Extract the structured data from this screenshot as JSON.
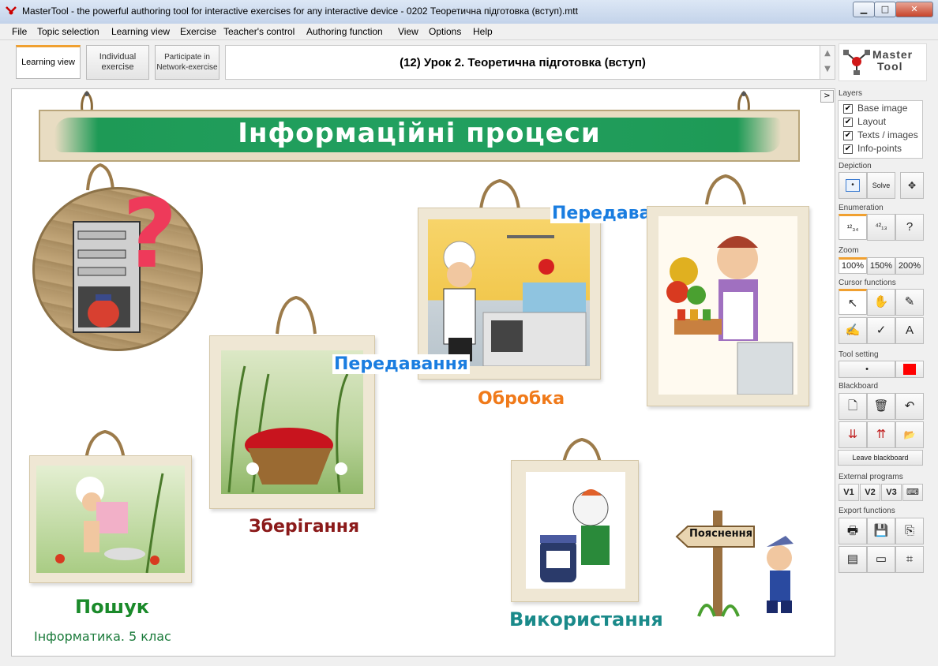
{
  "window": {
    "title": "MasterTool - the powerful authoring tool for interactive exercises for any interactive device - 0202 Теоретична підготовка (вступ).mtt",
    "controls": {
      "minimize": "▁",
      "maximize": "□",
      "close": "✕"
    }
  },
  "menu": [
    "File",
    "Topic selection",
    "Learning view",
    "Exercise",
    "Teacher's control",
    "Authoring function",
    "View",
    "Options",
    "Help"
  ],
  "toolbar": {
    "learning_view": "Learning view",
    "individual_exercise": "Individual exercise",
    "network_exercise": "Participate in Network-exercise",
    "lesson_title": "(12) Урок 2. Теоретична підготовка (вступ)",
    "scroll_up": "▲",
    "scroll_down": "▼",
    "logo_line1": "Master",
    "logo_line2": "Tool"
  },
  "canvas": {
    "collapse": ">",
    "banner": "Інформаційні процеси",
    "question_mark": "?",
    "labels": {
      "transfer_top": "Передавання",
      "transfer_middle": "Передавання",
      "processing": "Обробка",
      "storing": "Зберігання",
      "search": "Пошук",
      "usage": "Використання",
      "subject": "Інформатика. 5 клас",
      "signpost": "Пояснення"
    }
  },
  "side_panel": {
    "layers": {
      "title": "Layers",
      "items": [
        {
          "label": "Base image",
          "checked": true
        },
        {
          "label": "Layout",
          "checked": true
        },
        {
          "label": "Texts / images",
          "checked": true
        },
        {
          "label": "Info-points",
          "checked": true
        }
      ]
    },
    "depiction": {
      "title": "Depiction",
      "solve": "Solve"
    },
    "enumeration": {
      "title": "Enumeration",
      "help": "?"
    },
    "zoom": {
      "title": "Zoom",
      "options": [
        "100%",
        "150%",
        "200%"
      ],
      "selected": "100%"
    },
    "cursor_functions": {
      "title": "Cursor functions",
      "text_tool": "A"
    },
    "tool_setting": {
      "title": "Tool setting",
      "color": "#ff0000"
    },
    "blackboard": {
      "title": "Blackboard",
      "leave": "Leave blackboard"
    },
    "external_programs": {
      "title": "External programs",
      "buttons": [
        "V1",
        "V2",
        "V3"
      ]
    },
    "export_functions": {
      "title": "Export functions"
    }
  },
  "colors": {
    "transfer": "#1a7de0",
    "processing": "#f07a1a",
    "storing": "#8b1a1a",
    "search": "#1a8a2a",
    "usage": "#1a8a8a",
    "subject": "#1a7a3a",
    "accent": "#f0a030"
  }
}
